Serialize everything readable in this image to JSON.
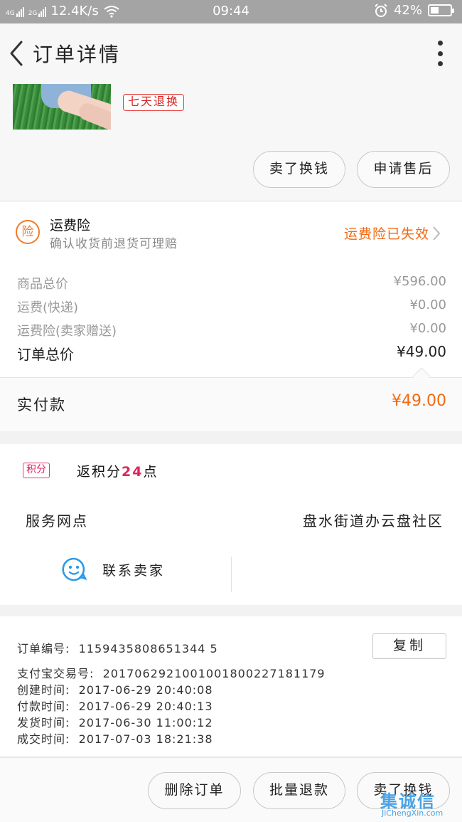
{
  "status_bar": {
    "signal1": "4G",
    "signal2": "2G",
    "speed": "12.4K/s",
    "time": "09:44",
    "battery": "42%",
    "battery_level": 0.42
  },
  "nav": {
    "title": "订单详情"
  },
  "product": {
    "tag": "七天退换",
    "btn_sell": "卖了换钱",
    "btn_aftersale": "申请售后"
  },
  "insurance": {
    "icon_char": "险",
    "name": "运费险",
    "desc": "确认收货前退货可理赔",
    "status": "运费险已失效",
    "accent": "#f06a14"
  },
  "price": {
    "rows": [
      {
        "label": "商品总价",
        "value": "¥596.00"
      },
      {
        "label": "运费(快递)",
        "value": "¥0.00"
      },
      {
        "label": "运费险(卖家赠送)",
        "value": "¥0.00"
      }
    ],
    "total_label": "订单总价",
    "total_value": "¥49.00",
    "paid_label": "实付款",
    "paid_value": "¥49.00"
  },
  "points": {
    "badge": "积分",
    "text_prefix": "返积分",
    "count": "24",
    "text_suffix": "点",
    "service_label": "服务网点",
    "service_value": "盘水街道办云盘社区",
    "contact": "联系卖家"
  },
  "order": {
    "number_label": "订单编号:",
    "number": "1159435808651344 5",
    "copy": "复制",
    "details": [
      {
        "label": "支付宝交易号:",
        "value": "2017062921001001800227181179"
      },
      {
        "label": "创建时间:",
        "value": "2017-06-29 20:40:08"
      },
      {
        "label": "付款时间:",
        "value": "2017-06-29 20:40:13"
      },
      {
        "label": "发货时间:",
        "value": "2017-06-30 11:00:12"
      },
      {
        "label": "成交时间:",
        "value": "2017-07-03 18:21:38"
      }
    ]
  },
  "bottom_actions": {
    "delete": "删除订单",
    "batch_refund": "批量退款",
    "sell": "卖了换钱"
  },
  "watermark": {
    "logo": "集诚信",
    "site": "JiChengXin.com"
  }
}
